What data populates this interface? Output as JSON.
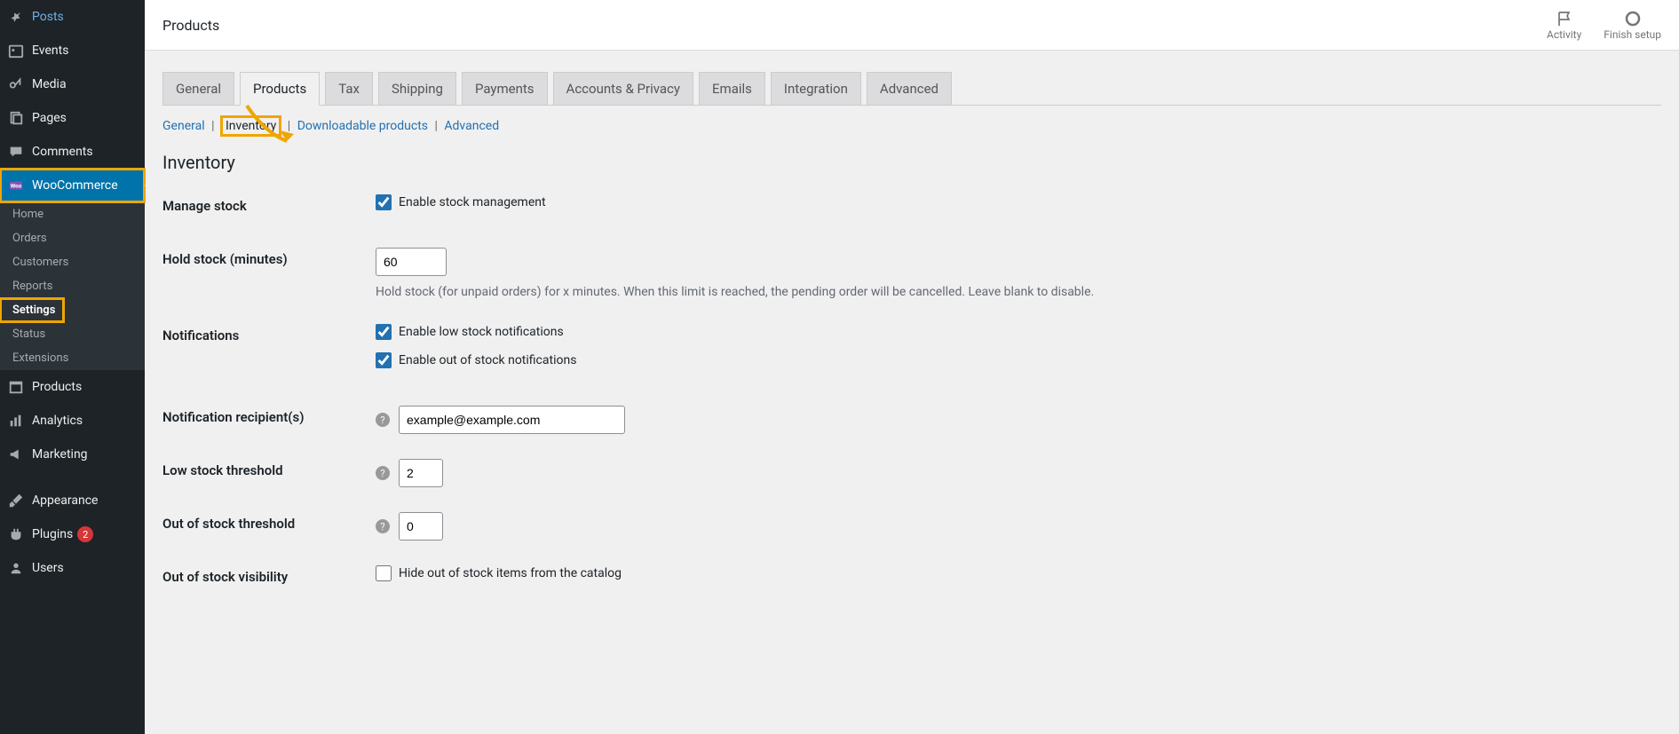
{
  "sidebar": {
    "items": [
      {
        "label": "Posts",
        "icon": "pin"
      },
      {
        "label": "Events",
        "icon": "calendar"
      },
      {
        "label": "Media",
        "icon": "media"
      },
      {
        "label": "Pages",
        "icon": "pages"
      },
      {
        "label": "Comments",
        "icon": "comment"
      },
      {
        "label": "WooCommerce",
        "icon": "woo",
        "active": true,
        "highlight": true
      },
      {
        "label": "Products",
        "icon": "archive"
      },
      {
        "label": "Analytics",
        "icon": "chart"
      },
      {
        "label": "Marketing",
        "icon": "megaphone"
      },
      {
        "label": "Appearance",
        "icon": "brush"
      },
      {
        "label": "Plugins",
        "icon": "plugin",
        "badge": "2"
      },
      {
        "label": "Users",
        "icon": "user"
      }
    ],
    "sub": [
      {
        "label": "Home"
      },
      {
        "label": "Orders"
      },
      {
        "label": "Customers"
      },
      {
        "label": "Reports"
      },
      {
        "label": "Settings",
        "current": true,
        "highlight": true
      },
      {
        "label": "Status"
      },
      {
        "label": "Extensions"
      }
    ]
  },
  "topbar": {
    "title": "Products",
    "actions": [
      {
        "label": "Activity",
        "icon": "flag"
      },
      {
        "label": "Finish setup",
        "icon": "circle"
      }
    ]
  },
  "tabs": [
    {
      "label": "General"
    },
    {
      "label": "Products",
      "active": true
    },
    {
      "label": "Tax"
    },
    {
      "label": "Shipping"
    },
    {
      "label": "Payments"
    },
    {
      "label": "Accounts & Privacy"
    },
    {
      "label": "Emails"
    },
    {
      "label": "Integration"
    },
    {
      "label": "Advanced"
    }
  ],
  "subtabs": [
    {
      "label": "General",
      "link": true
    },
    {
      "label": "Inventory",
      "active": true,
      "highlight": true
    },
    {
      "label": "Downloadable products",
      "link": true
    },
    {
      "label": "Advanced",
      "link": true
    }
  ],
  "section_title": "Inventory",
  "fields": {
    "manage_stock": {
      "label": "Manage stock",
      "checkbox_label": "Enable stock management",
      "checked": true
    },
    "hold_stock": {
      "label": "Hold stock (minutes)",
      "value": "60",
      "help": "Hold stock (for unpaid orders) for x minutes. When this limit is reached, the pending order will be cancelled. Leave blank to disable."
    },
    "notifications": {
      "label": "Notifications",
      "low_label": "Enable low stock notifications",
      "low_checked": true,
      "out_label": "Enable out of stock notifications",
      "out_checked": true
    },
    "recipients": {
      "label": "Notification recipient(s)",
      "value": "example@example.com"
    },
    "low_threshold": {
      "label": "Low stock threshold",
      "value": "2"
    },
    "out_threshold": {
      "label": "Out of stock threshold",
      "value": "0"
    },
    "visibility": {
      "label": "Out of stock visibility",
      "checkbox_label": "Hide out of stock items from the catalog",
      "checked": false
    }
  }
}
